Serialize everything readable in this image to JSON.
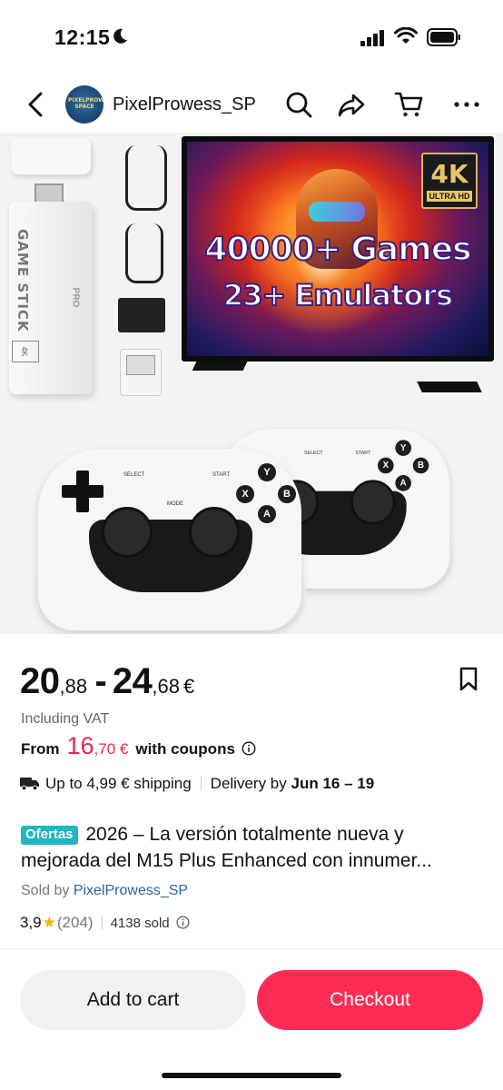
{
  "status_bar": {
    "time": "12:15"
  },
  "header": {
    "store_name": "PixelProwess_SP",
    "store_logo_text": "PIXELPROWESS SPACE"
  },
  "hero": {
    "promo_line1": "40000+ Games",
    "promo_line2": "23+ Emulators",
    "badge_big": "4K",
    "badge_small": "ULTRA HD",
    "stick_label": "GAME STICK",
    "stick_sub": "PRO",
    "stick_badge": "4K",
    "pad_select": "SELECT",
    "pad_start": "START",
    "pad_mode": "MODE",
    "pad_y": "Y",
    "pad_x": "X",
    "pad_b": "B",
    "pad_a": "A",
    "carousel_total": 5,
    "carousel_active": 1
  },
  "price": {
    "low_int": "20",
    "low_dec": ",88",
    "separator": "-",
    "high_int": "24",
    "high_dec": ",68",
    "currency": "€",
    "vat_note": "Including VAT",
    "from_label": "From",
    "coupon_int": "16",
    "coupon_dec": ",70 €",
    "coupon_suffix": "with coupons"
  },
  "shipping": {
    "shipping_text": "Up to 4,99 € shipping",
    "delivery_prefix": "Delivery by",
    "delivery_dates": "Jun 16 – 19"
  },
  "product": {
    "tag": "Ofertas",
    "title_line1": "2026 – La versión totalmente nueva y",
    "title_line2": "mejorada del M15 Plus Enhanced con innumer..."
  },
  "seller": {
    "prefix": "Sold by",
    "name": "PixelProwess_SP"
  },
  "rating": {
    "score": "3,9",
    "count": "(204)",
    "sold": "4138 sold"
  },
  "actions": {
    "add_to_cart": "Add to cart",
    "checkout": "Checkout"
  },
  "colors": {
    "accent": "#fe2c55",
    "price_red": "#e8284c",
    "tag_teal": "#1fb8c1",
    "link_blue": "#2f5fa3",
    "star": "#f5b400"
  }
}
